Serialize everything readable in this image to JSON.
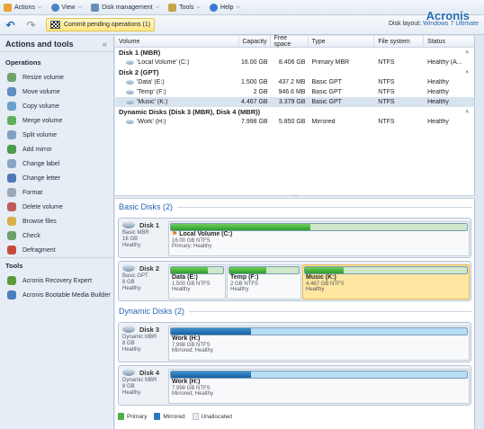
{
  "menubar": {
    "items": [
      {
        "label": "Actions",
        "icon": "actions-icon",
        "color": "#e8a33a"
      },
      {
        "label": "View",
        "icon": "eye-icon",
        "color": "#4a84c6"
      },
      {
        "label": "Disk management",
        "icon": "disk-icon",
        "color": "#6a8fb5"
      },
      {
        "label": "Tools",
        "icon": "tools-icon",
        "color": "#c5a54a"
      },
      {
        "label": "Help",
        "icon": "help-icon",
        "color": "#3a7bd1"
      }
    ],
    "logo": "Acronis"
  },
  "toolbar": {
    "undo": "↶",
    "redo": "↷",
    "commit_label": "Commit pending operations (1)",
    "layout_label": "Disk layout:",
    "layout_value": "Windows 7 Ultimate"
  },
  "sidebar": {
    "title": "Actions and tools",
    "collapse": "«",
    "operations_title": "Operations",
    "operations": [
      {
        "label": "Resize volume",
        "icon": "resize-volume-icon",
        "color": "#6fa36a"
      },
      {
        "label": "Move volume",
        "icon": "move-volume-icon",
        "color": "#5f8ec0"
      },
      {
        "label": "Copy volume",
        "icon": "copy-volume-icon",
        "color": "#6aa0c9"
      },
      {
        "label": "Merge volume",
        "icon": "merge-volume-icon",
        "color": "#5fb05a"
      },
      {
        "label": "Split volume",
        "icon": "split-volume-icon",
        "color": "#7fa1c4"
      },
      {
        "label": "Add mirror",
        "icon": "add-mirror-icon",
        "color": "#4c9a4c"
      },
      {
        "label": "Change label",
        "icon": "change-label-icon",
        "color": "#8ba6c2"
      },
      {
        "label": "Change letter",
        "icon": "change-letter-icon",
        "color": "#4f78b8"
      },
      {
        "label": "Format",
        "icon": "format-icon",
        "color": "#9aa9b8"
      },
      {
        "label": "Delete volume",
        "icon": "delete-volume-icon",
        "color": "#c25a5a"
      },
      {
        "label": "Browse files",
        "icon": "browse-files-icon",
        "color": "#d8b04a"
      },
      {
        "label": "Check",
        "icon": "check-icon",
        "color": "#6aa06a"
      },
      {
        "label": "Defragment",
        "icon": "defragment-icon",
        "color": "#c94a3a"
      }
    ],
    "tools_title": "Tools",
    "tools": [
      {
        "label": "Acronis Recovery Expert",
        "icon": "recovery-expert-icon",
        "color": "#5a9a3a"
      },
      {
        "label": "Acronis Bootable Media Builder",
        "icon": "media-builder-icon",
        "color": "#4a7fc0"
      }
    ]
  },
  "table": {
    "columns": [
      "Volume",
      "Capacity",
      "Free space",
      "Type",
      "File system",
      "Status"
    ],
    "groups": [
      {
        "title": "Disk 1 (MBR)",
        "rows": [
          {
            "volume": "'Local Volume' (C:)",
            "capacity": "16.00 GB",
            "free": "8.406 GB",
            "type": "Primary MBR",
            "fs": "NTFS",
            "status": "Healthy (A..."
          }
        ]
      },
      {
        "title": "Disk 2 (GPT)",
        "rows": [
          {
            "volume": "'Data' (E:)",
            "capacity": "1.500 GB",
            "free": "437.2 MB",
            "type": "Basic GPT",
            "fs": "NTFS",
            "status": "Healthy"
          },
          {
            "volume": "'Temp' (F:)",
            "capacity": "2 GB",
            "free": "946.6 MB",
            "type": "Basic GPT",
            "fs": "NTFS",
            "status": "Healthy"
          },
          {
            "volume": "'Music' (K:)",
            "capacity": "4.467 GB",
            "free": "3.379 GB",
            "type": "Basic GPT",
            "fs": "NTFS",
            "status": "Healthy"
          }
        ]
      },
      {
        "title": "Dynamic Disks (Disk 3 (MBR), Disk 4 (MBR))",
        "rows": [
          {
            "volume": "'Work' (H:)",
            "capacity": "7.998 GB",
            "free": "5.850 GB",
            "type": "Mirrored",
            "fs": "NTFS",
            "status": "Healthy"
          }
        ]
      }
    ]
  },
  "basic_disks": {
    "title": "Basic Disks (2)",
    "disk1": {
      "name": "Disk 1",
      "type": "Basic MBR",
      "size": "16 GB",
      "status": "Healthy",
      "part": {
        "name": "Local Volume (C:)",
        "detail": "16.00 GB NTFS",
        "status": "Primary; Healthy",
        "used": 0.47
      }
    },
    "disk2": {
      "name": "Disk 2",
      "type": "Basic GPT",
      "size": "8 GB",
      "status": "Healthy",
      "parts": [
        {
          "name": "Data (E:)",
          "detail": "1.500 GB NTFS",
          "status": "Healthy",
          "used": 0.71
        },
        {
          "name": "Temp (F:)",
          "detail": "2 GB NTFS",
          "status": "Healthy",
          "used": 0.53
        },
        {
          "name": "Music (K:)",
          "detail": "4.467 GB NTFS",
          "status": "Healthy",
          "used": 0.24
        }
      ]
    }
  },
  "dynamic_disks": {
    "title": "Dynamic Disks (2)",
    "disks": [
      {
        "name": "Disk 3",
        "type": "Dynamic MBR",
        "size": "8 GB",
        "status": "Healthy",
        "part": {
          "name": "Work (H:)",
          "detail": "7.998 GB NTFS",
          "status": "Mirrored; Healthy",
          "used": 0.27
        }
      },
      {
        "name": "Disk 4",
        "type": "Dynamic MBR",
        "size": "8 GB",
        "status": "Healthy",
        "part": {
          "name": "Work (H:)",
          "detail": "7.998 GB NTFS",
          "status": "Mirrored; Healthy",
          "used": 0.27
        }
      }
    ]
  },
  "legend": [
    {
      "label": "Primary",
      "color": "#4caf4a"
    },
    {
      "label": "Mirrored",
      "color": "#2b78c2"
    },
    {
      "label": "Unallocated",
      "color": "#e8ecf0"
    }
  ]
}
